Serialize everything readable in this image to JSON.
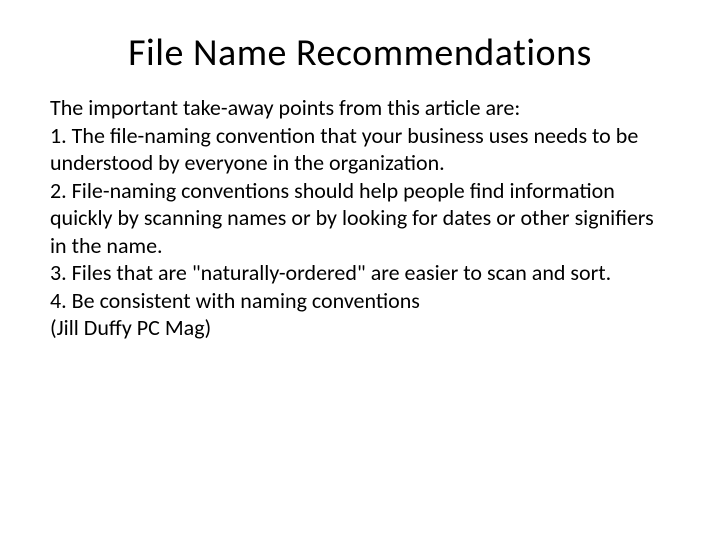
{
  "title": "File Name Recommendations",
  "intro": "The important take-away points from this article are:",
  "point1": "1. The file-naming convention that your business uses needs to be understood by everyone in the organization.",
  "point2": "2. File-naming conventions should help people find information quickly by scanning names or by looking for dates or other signifiers in the name.",
  "point3": "3. Files that are \"naturally-ordered\" are easier to scan and sort.",
  "point4": "4. Be consistent with naming conventions",
  "attribution": "(Jill Duffy PC Mag)"
}
